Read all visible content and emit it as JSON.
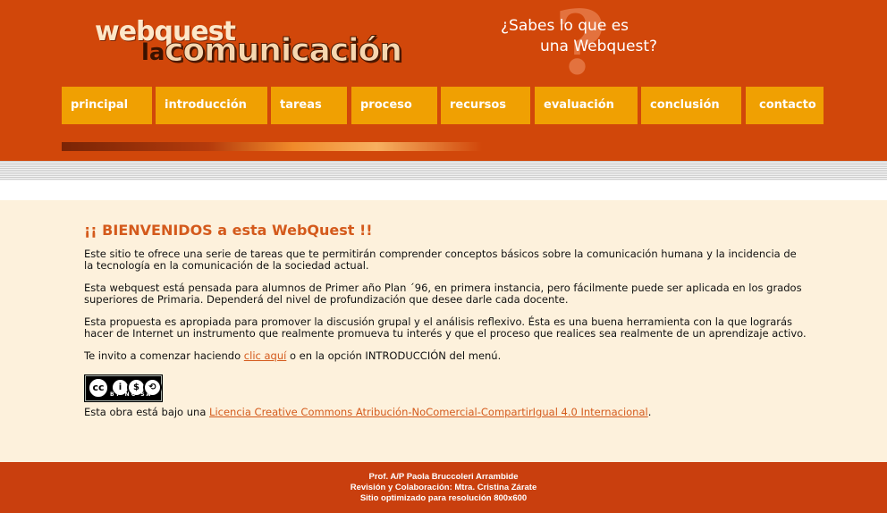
{
  "header": {
    "logo_top": "webquest",
    "logo_small": "la",
    "logo_main": "comunicación",
    "tagline_line1": "¿Sabes lo que es",
    "tagline_line2": "una Webquest?",
    "question_glyph": "?"
  },
  "nav": {
    "items": [
      {
        "label": "principal"
      },
      {
        "label": "introducción"
      },
      {
        "label": "tareas"
      },
      {
        "label": "proceso"
      },
      {
        "label": "recursos"
      },
      {
        "label": "evaluación"
      },
      {
        "label": "conclusión"
      },
      {
        "label": "contacto"
      }
    ]
  },
  "main": {
    "title": "¡¡ BIENVENIDOS a esta WebQuest !!",
    "p1": "Este sitio te ofrece una serie de tareas que te permitirán comprender conceptos básicos sobre la comunicación humana y la incidencia de la tecnología en la comunicación de la sociedad actual.",
    "p2": "Esta webquest está pensada para alumnos de Primer año Plan ´96, en primera instancia, pero fácilmente puede ser aplicada en los grados superiores de Primaria. Dependerá del nivel de profundización que desee darle cada docente.",
    "p3": "Esta propuesta es apropiada para promover la discusión grupal y el análisis reflexivo. Ésta es una buena herramienta con la que lograrás hacer de Internet un instrumento que realmente promueva tu interés y que el proceso que realices sea realmente de un aprendizaje activo.",
    "invite_before": "Te invito a comenzar haciendo ",
    "invite_link": "clic aquí",
    "invite_after": " o en la opción INTRODUCCIÓN del menú.",
    "cc_badge": {
      "main": "cc",
      "icons": [
        "i",
        "$",
        "⟲"
      ],
      "labels": "BY NC SA"
    },
    "license_before": "Esta obra está bajo una ",
    "license_link": "Licencia Creative Commons Atribución-NoComercial-CompartirIgual 4.0 Internacional",
    "license_after": "."
  },
  "footer": {
    "line1": "Prof. A/P Paola Bruccoleri Arrambide",
    "line2": "Revisión y Colaboración: Mtra. Cristina Zárate",
    "line3": "Sitio optimizado para resolución 800x600"
  },
  "colors": {
    "header_bg": "#d1470a",
    "nav_bg": "#f0a002",
    "content_bg": "#fdf1dc",
    "heading": "#d45a1c",
    "footer_bg": "#c93f0e"
  }
}
